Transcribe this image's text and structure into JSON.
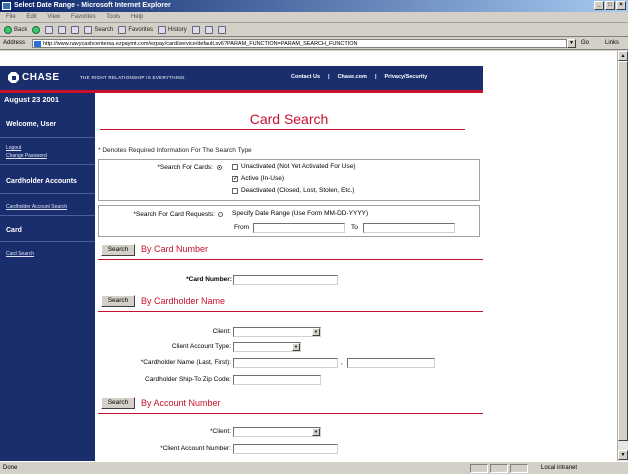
{
  "window": {
    "title": "Select Date Range - Microsoft Internet Explorer",
    "menu": [
      "File",
      "Edit",
      "View",
      "Favorites",
      "Tools",
      "Help"
    ],
    "toolbar": [
      "Back",
      "Search",
      "Favorites",
      "History"
    ],
    "address_label": "Address",
    "address": "http://www.navycashcentersa.ezpaymt.com/ezpay/card/service/default.sv6?PARAM_FUNCTION=PARAM_SEARCH_FUNCTION",
    "go_label": "Go",
    "links_label": "Links",
    "status_done": "Done",
    "status_zone": "Local intranet"
  },
  "header": {
    "logo": "CHASE",
    "tagline": "THE RIGHT RELATIONSHIP IS EVERYTHING.",
    "nav": [
      "Contact Us",
      "|",
      "Chase.com",
      "|",
      "Privacy/Security"
    ]
  },
  "sidebar": {
    "date": "August 23 2001",
    "welcome": "Welcome, User",
    "logout": "Logout",
    "change_password": "Change Password",
    "cardholder_accounts": "Cardholder Accounts",
    "cardholder_account_search": "Cardholder Account Search",
    "card": "Card",
    "card_search": "Card Search"
  },
  "page": {
    "title": "Card Search",
    "required_note": "* Denotes Required Information For The Search Type",
    "search_for_cards_label": "*Search For Cards:",
    "opt_unactivated": "Unactivated (Not Yet Activated For Use)",
    "opt_active": "Active (In-Use)",
    "opt_deactivated": "Deactivated (Closed, Lost, Stolen, Etc.)",
    "search_requests_label": "*Search For Card Requests:",
    "date_range_label": "Specify Date Range (Use Form MM-DD-YYYY)",
    "from_label": "From",
    "to_label": "To",
    "search_button": "Search",
    "by_card_number": "By Card Number",
    "card_number_label": "*Card Number:",
    "by_cardholder_name": "By Cardholder Name",
    "client_label": "Client:",
    "client_account_type_label": "Client Account Type:",
    "cardholder_name_label": "*Cardholder Name (Last, First):",
    "name_separator": ",",
    "zip_label": "Cardholder Ship-To Zip Code:",
    "by_account_number": "By Account Number",
    "client_label_req": "*Client:",
    "client_account_number_label": "*Client Account Number:"
  },
  "colors": {
    "navy": "#1a2e6e",
    "red": "#c8102e"
  }
}
